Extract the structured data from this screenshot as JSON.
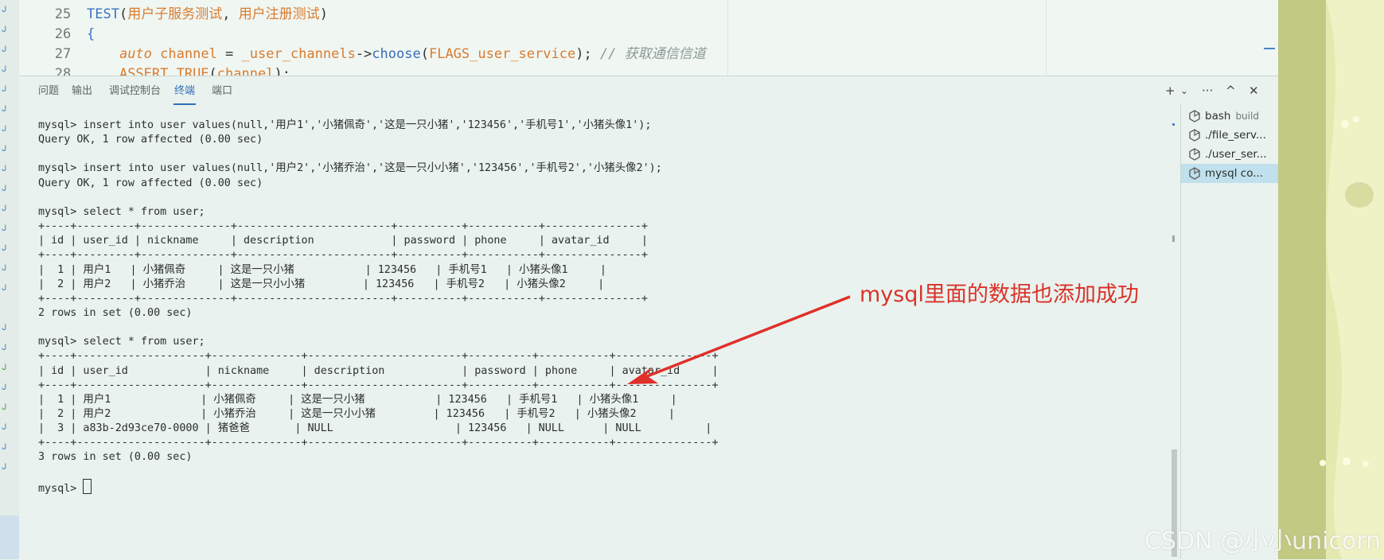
{
  "colors": {
    "accent": "#2f6fb8",
    "annotation": "#d9332a",
    "background": "#e9f2ee"
  },
  "editor": {
    "lines": [
      {
        "number": "25",
        "tokens": [
          {
            "t": "TEST",
            "c": "kw"
          },
          {
            "t": "(",
            "c": "op"
          },
          {
            "t": "用户子服务测试",
            "c": "str"
          },
          {
            "t": ", ",
            "c": "op"
          },
          {
            "t": "用户注册测试",
            "c": "str"
          },
          {
            "t": ")",
            "c": "op"
          }
        ]
      },
      {
        "number": "26",
        "tokens": [
          {
            "t": "{",
            "c": "kw"
          }
        ]
      },
      {
        "number": "27",
        "tokens": [
          {
            "t": "    ",
            "c": "op"
          },
          {
            "t": "auto",
            "c": "type"
          },
          {
            "t": " channel",
            "c": "var"
          },
          {
            "t": " = ",
            "c": "op"
          },
          {
            "t": "_user_channels",
            "c": "var"
          },
          {
            "t": "->",
            "c": "op"
          },
          {
            "t": "choose",
            "c": "fn"
          },
          {
            "t": "(",
            "c": "op"
          },
          {
            "t": "FLAGS_user_service",
            "c": "var"
          },
          {
            "t": "); ",
            "c": "op"
          },
          {
            "t": "// 获取通信信道",
            "c": "cmt"
          }
        ]
      },
      {
        "number": "28",
        "tokens": [
          {
            "t": "    ",
            "c": "op"
          },
          {
            "t": "ASSERT_TRUE",
            "c": "var"
          },
          {
            "t": "(",
            "c": "op"
          },
          {
            "t": "channel",
            "c": "var"
          },
          {
            "t": ");",
            "c": "op"
          }
        ]
      }
    ]
  },
  "panel": {
    "tabs": [
      {
        "label": "问题",
        "active": false
      },
      {
        "label": "输出",
        "active": false
      },
      {
        "label": "调试控制台",
        "active": false
      },
      {
        "label": "终端",
        "active": true
      },
      {
        "label": "端口",
        "active": false
      }
    ],
    "controls": {
      "new_terminal": "+",
      "dropdown": "⌄",
      "more": "···",
      "maximize": "^",
      "close": "✕"
    }
  },
  "terminal": {
    "lines": [
      "mysql> insert into user values(null,'用户1','小猪佩奇','这是一只小猪','123456','手机号1','小猪头像1');",
      "Query OK, 1 row affected (0.00 sec)",
      "",
      "mysql> insert into user values(null,'用户2','小猪乔治','这是一只小小猪','123456','手机号2','小猪头像2');",
      "Query OK, 1 row affected (0.00 sec)",
      "",
      "mysql> select * from user;",
      "+----+---------+--------------+------------------------+----------+-----------+---------------+",
      "| id | user_id | nickname     | description            | password | phone     | avatar_id     |",
      "+----+---------+--------------+------------------------+----------+-----------+---------------+",
      "|  1 | 用户1   | 小猪佩奇     | 这是一只小猪           | 123456   | 手机号1   | 小猪头像1     |",
      "|  2 | 用户2   | 小猪乔治     | 这是一只小小猪         | 123456   | 手机号2   | 小猪头像2     |",
      "+----+---------+--------------+------------------------+----------+-----------+---------------+",
      "2 rows in set (0.00 sec)",
      "",
      "mysql> select * from user;",
      "+----+--------------------+--------------+------------------------+----------+-----------+---------------+",
      "| id | user_id            | nickname     | description            | password | phone     | avatar_id     |",
      "+----+--------------------+--------------+------------------------+----------+-----------+---------------+",
      "|  1 | 用户1              | 小猪佩奇     | 这是一只小猪           | 123456   | 手机号1   | 小猪头像1     |",
      "|  2 | 用户2              | 小猪乔治     | 这是一只小小猪         | 123456   | 手机号2   | 小猪头像2     |",
      "|  3 | a83b-2d93ce70-0000 | 猪爸爸       | NULL                   | 123456   | NULL      | NULL          |",
      "+----+--------------------+--------------+------------------------+----------+-----------+---------------+",
      "3 rows in set (0.00 sec)",
      "",
      "mysql> "
    ]
  },
  "terminal_list": {
    "items": [
      {
        "label": "bash",
        "sub": "build",
        "selected": false,
        "icon": "terminal-icon"
      },
      {
        "label": "./file_serv...",
        "sub": "",
        "selected": false,
        "icon": "terminal-icon"
      },
      {
        "label": "./user_ser...",
        "sub": "",
        "selected": false,
        "icon": "terminal-icon"
      },
      {
        "label": "mysql  co...",
        "sub": "",
        "selected": true,
        "icon": "terminal-icon"
      }
    ]
  },
  "annotation": {
    "text": "mysql里面的数据也添加成功"
  },
  "watermark": {
    "text": "CSDN @小小unicorn"
  }
}
